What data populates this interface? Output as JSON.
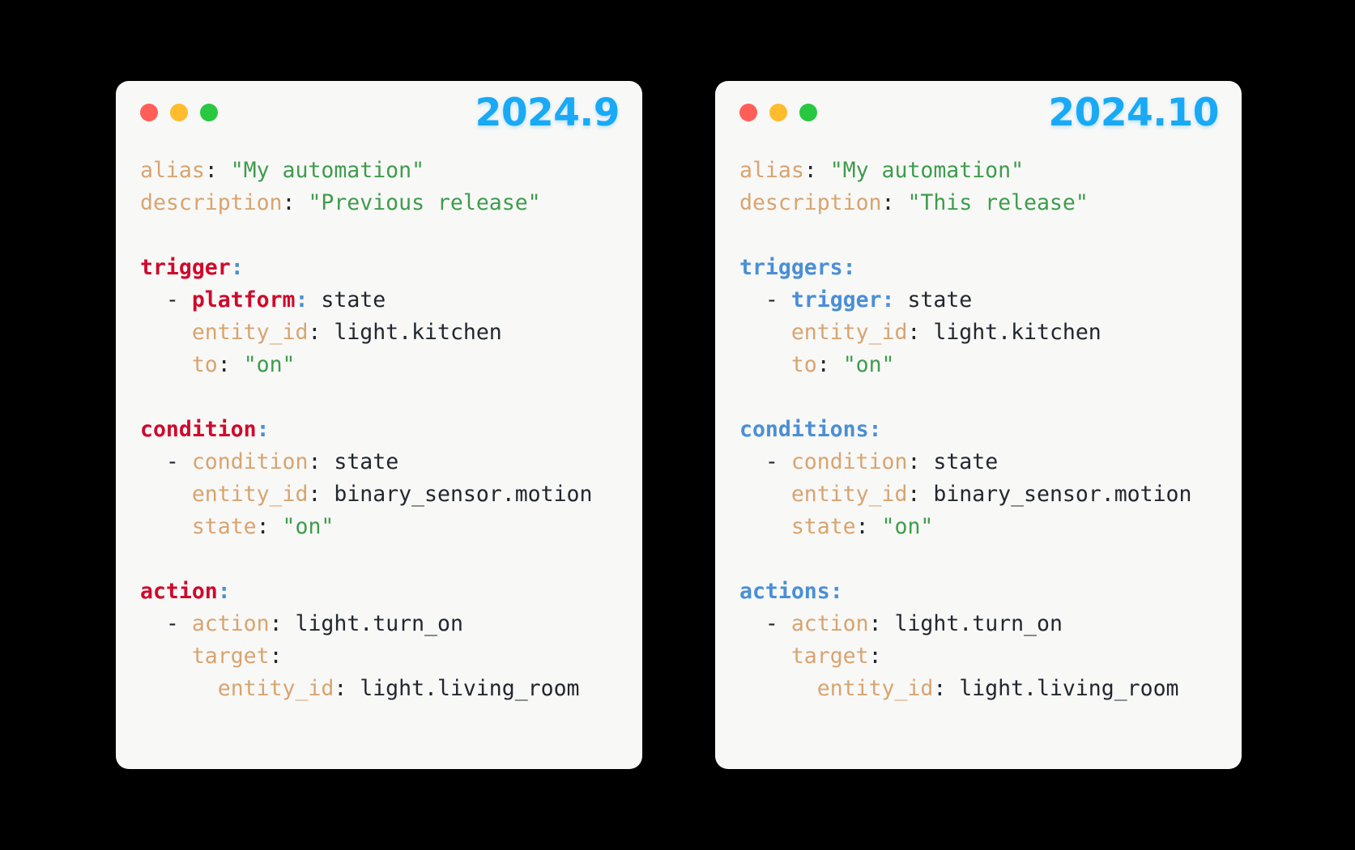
{
  "cards": [
    {
      "id": "previous-release",
      "version": "2024.9",
      "version_color": "#19a9f5",
      "window_dots": [
        "close-red",
        "minimize-yellow",
        "maximize-green"
      ],
      "accent_key_color": "#cf0a2c",
      "lines": [
        {
          "type": "pair",
          "indent": 0,
          "key": "alias",
          "value": "\"My automation\"",
          "value_kind": "string"
        },
        {
          "type": "pair",
          "indent": 0,
          "key": "description",
          "value": "\"Previous release\"",
          "value_kind": "string"
        },
        {
          "type": "blank"
        },
        {
          "type": "section",
          "indent": 0,
          "key": "trigger",
          "highlight": "old"
        },
        {
          "type": "item-pair",
          "indent": 1,
          "key": "platform",
          "value": "state",
          "value_kind": "plain",
          "highlight": "old"
        },
        {
          "type": "pair",
          "indent": 2,
          "key": "entity_id",
          "value": "light.kitchen",
          "value_kind": "plain"
        },
        {
          "type": "pair",
          "indent": 2,
          "key": "to",
          "value": "\"on\"",
          "value_kind": "string"
        },
        {
          "type": "blank"
        },
        {
          "type": "section",
          "indent": 0,
          "key": "condition",
          "highlight": "old"
        },
        {
          "type": "item-pair",
          "indent": 1,
          "key": "condition",
          "value": "state",
          "value_kind": "plain"
        },
        {
          "type": "pair",
          "indent": 2,
          "key": "entity_id",
          "value": "binary_sensor.motion",
          "value_kind": "plain"
        },
        {
          "type": "pair",
          "indent": 2,
          "key": "state",
          "value": "\"on\"",
          "value_kind": "string"
        },
        {
          "type": "blank"
        },
        {
          "type": "section",
          "indent": 0,
          "key": "action",
          "highlight": "old"
        },
        {
          "type": "item-pair",
          "indent": 1,
          "key": "action",
          "value": "light.turn_on",
          "value_kind": "plain"
        },
        {
          "type": "section",
          "indent": 2,
          "key": "target"
        },
        {
          "type": "pair",
          "indent": 3,
          "key": "entity_id",
          "value": "light.living_room",
          "value_kind": "plain"
        }
      ]
    },
    {
      "id": "this-release",
      "version": "2024.10",
      "version_color": "#19a9f5",
      "window_dots": [
        "close-red",
        "minimize-yellow",
        "maximize-green"
      ],
      "accent_key_color": "#4a8fd6",
      "lines": [
        {
          "type": "pair",
          "indent": 0,
          "key": "alias",
          "value": "\"My automation\"",
          "value_kind": "string"
        },
        {
          "type": "pair",
          "indent": 0,
          "key": "description",
          "value": "\"This release\"",
          "value_kind": "string"
        },
        {
          "type": "blank"
        },
        {
          "type": "section",
          "indent": 0,
          "key": "triggers",
          "highlight": "new"
        },
        {
          "type": "item-pair",
          "indent": 1,
          "key": "trigger",
          "value": "state",
          "value_kind": "plain",
          "highlight": "new"
        },
        {
          "type": "pair",
          "indent": 2,
          "key": "entity_id",
          "value": "light.kitchen",
          "value_kind": "plain"
        },
        {
          "type": "pair",
          "indent": 2,
          "key": "to",
          "value": "\"on\"",
          "value_kind": "string"
        },
        {
          "type": "blank"
        },
        {
          "type": "section",
          "indent": 0,
          "key": "conditions",
          "highlight": "new"
        },
        {
          "type": "item-pair",
          "indent": 1,
          "key": "condition",
          "value": "state",
          "value_kind": "plain"
        },
        {
          "type": "pair",
          "indent": 2,
          "key": "entity_id",
          "value": "binary_sensor.motion",
          "value_kind": "plain"
        },
        {
          "type": "pair",
          "indent": 2,
          "key": "state",
          "value": "\"on\"",
          "value_kind": "string"
        },
        {
          "type": "blank"
        },
        {
          "type": "section",
          "indent": 0,
          "key": "actions",
          "highlight": "new"
        },
        {
          "type": "item-pair",
          "indent": 1,
          "key": "action",
          "value": "light.turn_on",
          "value_kind": "plain"
        },
        {
          "type": "section",
          "indent": 2,
          "key": "target"
        },
        {
          "type": "pair",
          "indent": 3,
          "key": "entity_id",
          "value": "light.living_room",
          "value_kind": "plain"
        }
      ]
    }
  ],
  "palette": {
    "background": "#000000",
    "card_background": "#f8f8f7",
    "key": "#d8a470",
    "string": "#3e9c4c",
    "plain_value": "#22272e",
    "old_accent": "#cf0a2c",
    "new_accent": "#4a8fd6",
    "version": "#19a9f5",
    "dot_red": "#ff5f57",
    "dot_yellow": "#febc2e",
    "dot_green": "#28c840"
  }
}
